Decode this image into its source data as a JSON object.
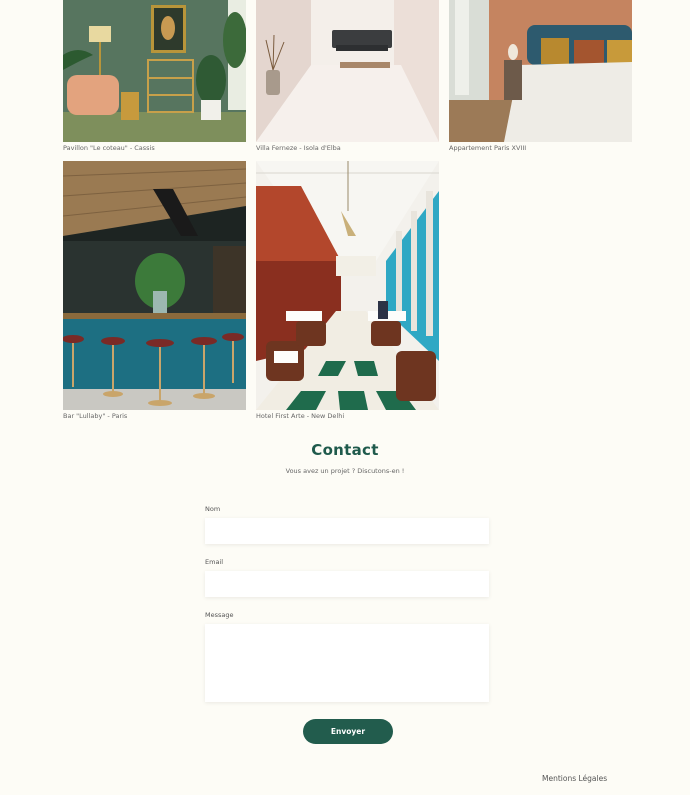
{
  "gallery": [
    {
      "caption": "Pavillon \"Le coteau\" - Cassis",
      "image": "green-living-room-photo"
    },
    {
      "caption": "Villa Ferneze - Isola d'Elba",
      "image": "white-lounge-photo"
    },
    {
      "caption": "Appartement Paris XVIII",
      "image": "bedroom-photo"
    },
    {
      "caption": "Bar \"Lullaby\" - Paris",
      "image": "teal-bar-photo"
    },
    {
      "caption": "Hotel First Arte - New Delhi",
      "image": "restaurant-hall-photo"
    }
  ],
  "contact": {
    "title": "Contact",
    "subtitle": "Vous avez un projet ? Discutons-en !",
    "name_label": "Nom",
    "email_label": "Email",
    "message_label": "Message",
    "send_label": "Envoyer"
  },
  "footer": {
    "legal_label": "Mentions Légales"
  },
  "colors": {
    "accent": "#225c4d",
    "background": "#fdfcf6"
  }
}
